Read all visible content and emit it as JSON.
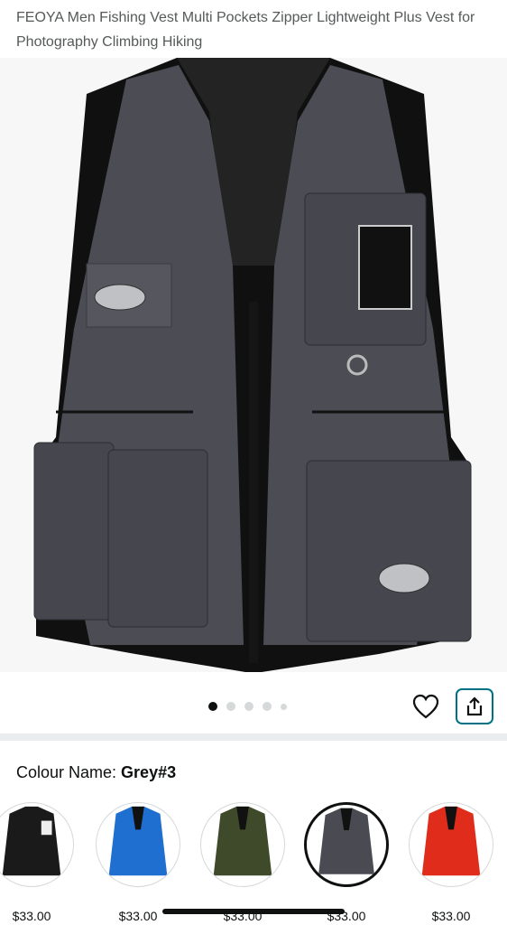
{
  "product": {
    "title": "FEOYA Men Fishing Vest Multi Pockets Zipper Lightweight Plus Vest for Photography Climbing Hiking"
  },
  "gallery": {
    "image_icon": "grey-fishing-vest-image",
    "dot_count": 5,
    "active_dot": 0
  },
  "actions": {
    "wishlist_icon": "heart-outline-icon",
    "share_icon": "share-icon",
    "accent_color": "#007185"
  },
  "colour": {
    "label": "Colour Name: ",
    "selected": "Grey#3"
  },
  "swatches": [
    {
      "colour": "#1a1a1a",
      "price": "$33.00"
    },
    {
      "colour": "#1f6fd1",
      "price": "$33.00"
    },
    {
      "colour": "#3f4a2a",
      "price": "$33.00"
    },
    {
      "colour": "#4a4b52",
      "price": "$33.00",
      "selected": true
    },
    {
      "colour": "#e02d1b",
      "price": "$33.00"
    }
  ]
}
